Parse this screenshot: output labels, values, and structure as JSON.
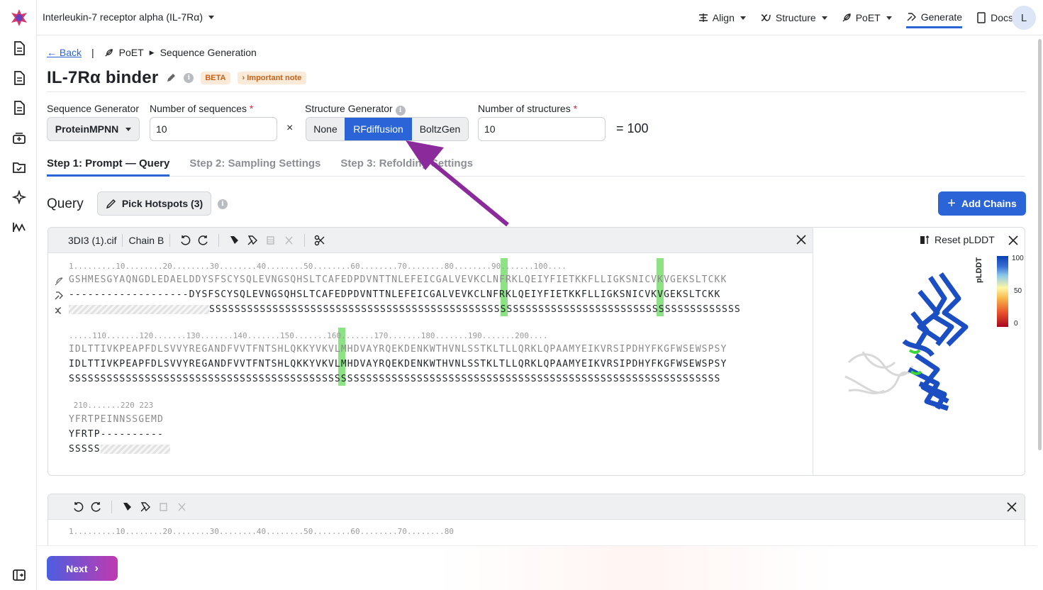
{
  "header": {
    "project": "Interleukin-7 receptor alpha (IL-7Rα)",
    "nav": [
      "Align",
      "Structure",
      "PoET",
      "Generate",
      "Docs"
    ],
    "avatar": "L"
  },
  "breadcrumb": {
    "back": "Back",
    "sep": "|",
    "section": "PoET",
    "page": "Sequence Generation"
  },
  "title": {
    "text": "IL-7Rα binder",
    "badge": "BETA",
    "note": "Important note"
  },
  "form": {
    "seq_gen_label": "Sequence Generator",
    "seq_gen_value": "ProteinMPNN",
    "num_seq_label": "Number of sequences",
    "num_seq_value": "10",
    "req": "*",
    "times": "×",
    "struct_gen_label": "Structure Generator",
    "struct_options": [
      "None",
      "RFdiffusion",
      "BoltzGen"
    ],
    "struct_selected": "RFdiffusion",
    "num_struct_label": "Number of structures",
    "num_struct_value": "10",
    "total": "= 100"
  },
  "tabs": [
    "Step 1: Prompt — Query",
    "Step 2: Sampling Settings",
    "Step 3: Refolding Settings"
  ],
  "query": {
    "heading": "Query",
    "hotspots": "Pick Hotspots (3)",
    "add_chains": "Add Chains"
  },
  "chain_card": {
    "file": "3DI3 (1).cif",
    "chain": "Chain B",
    "reset": "Reset pLDDT",
    "legend_title": "pLDDT",
    "legend_ticks": [
      "100",
      "50",
      "0"
    ],
    "blocks": [
      {
        "ruler": "1.........10........20........30........40........50........60........70........80........90.......100....",
        "ref": "GSHMESGYAQNGDLEDAELDDYSFSCYSQLEVNGSQHSLTCAFEDPDVNTTNLEFEICGALVEVKCLNFRKLQEIYFIETKKFLLIGKSNICVKVGEKSLTCKK",
        "seq_gap": "-------------------",
        "seq": "DYSFSCYSQLEVNGSQHSLTCAFEDPDVNTTNLEFEICGALVEVKCLNFRKLQEIYFIETKKFLLIGKSNICVKVGEKSLTCKK",
        "ss": "SSSSSSSSSSSSSSSSSSSSSSSSSSSSSSSSSSSSSSSSSSSSSSSSSSSSSSSSSSSSSSSSSSSSSSSSSSSSSSSSSSSS"
      },
      {
        "ruler": ".....110.......120.......130.......140.......150.......160.......170.......180.......190.......200....",
        "ref": "IDLTTIVKPEAPFDLSVVYREGANDFVVTFNTSHLQKKYVKVLMHDVAYRQEKDENKWTHVNLSSTKLTLLQRKLQPAAMYEIKVRSIPDHYFKGFWSEWSPSY",
        "seq": "IDLTTIVKPEAPFDLSVVYREGANDFVVTFNTSHLQKKYVKVLMHDVAYRQEKDENKWTHVNLSSTKLTLLQRKLQPAAMYEIKVRSIPDHYFKGFWSEWSPSY",
        "ss": "SSSSSSSSSSSSSSSSSSSSSSSSSSSSSSSSSSSSSSSSSSSSSSSSSSSSSSSSSSSSSSSSSSSSSSSSSSSSSSSSSSSSSSSSSSSSSSSSSSSSSSS"
      },
      {
        "ruler": " 210.......220 223",
        "ref": "YFRTPEINNSSGEMD",
        "seq": "YFRTP----------",
        "ss": "SSSSS"
      }
    ]
  },
  "chain_card2": {
    "ruler": "1.........10........20........30........40........50........60........70........80"
  },
  "footer": {
    "next": "Next"
  }
}
